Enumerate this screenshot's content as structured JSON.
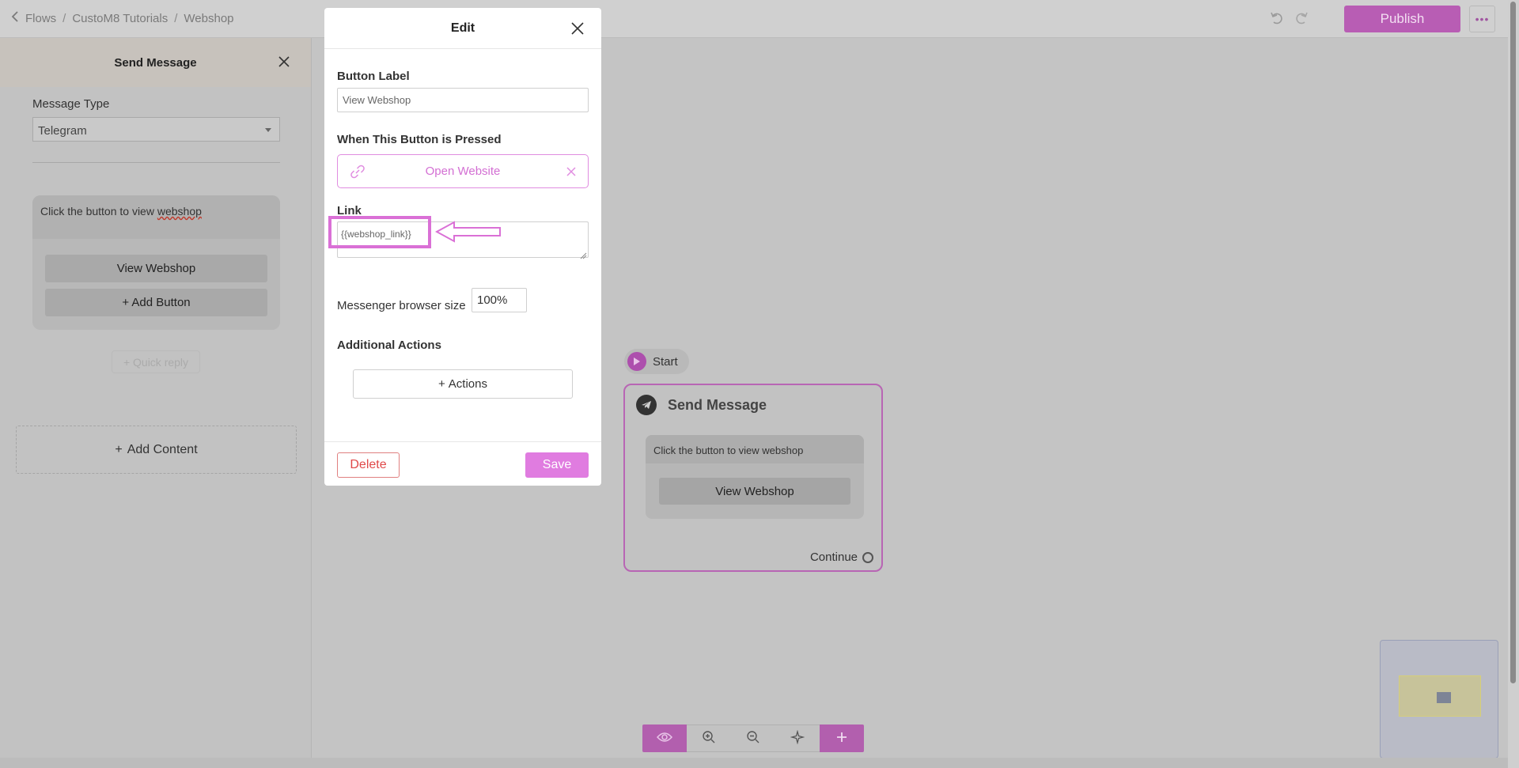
{
  "breadcrumb": {
    "items": [
      "Flows",
      "CustoM8 Tutorials",
      "Webshop"
    ],
    "separator": "/"
  },
  "toolbar": {
    "publish_label": "Publish",
    "more_label": "•••"
  },
  "left_panel": {
    "title": "Send Message",
    "message_type_label": "Message Type",
    "message_type_value": "Telegram",
    "message_text_prefix": "Click the button to view ",
    "message_text_word": "webshop",
    "buttons": [
      "View Webshop",
      "+ Add Button"
    ],
    "quick_reply_label": "+ Quick reply",
    "add_content_label": "Add Content",
    "add_content_plus": "+"
  },
  "canvas": {
    "start_label": "Start",
    "node": {
      "title": "Send Message",
      "text": "Click the button to view webshop",
      "button_label": "View Webshop",
      "continue_label": "Continue"
    }
  },
  "modal": {
    "title": "Edit",
    "button_label_heading": "Button Label",
    "button_label_value": "View Webshop",
    "pressed_heading": "When This Button is Pressed",
    "action_value": "Open Website",
    "link_heading": "Link",
    "link_value": "{{webshop_link}}",
    "browser_size_label": "Messenger browser size",
    "browser_size_value": "100%",
    "additional_actions_heading": "Additional Actions",
    "actions_button_label": "Actions",
    "actions_button_plus": "+",
    "delete_label": "Delete",
    "save_label": "Save"
  },
  "colors": {
    "accent": "#e07ce0",
    "accent_dim": "#b85db4",
    "highlight": "#da70d6",
    "danger": "#e04848"
  },
  "icons": [
    "chevron-left-icon",
    "undo-icon",
    "redo-icon",
    "close-icon",
    "caret-down-icon",
    "play-icon",
    "telegram-icon",
    "link-icon",
    "eye-icon",
    "zoom-in-icon",
    "zoom-out-icon",
    "sparkle-icon",
    "plus-icon",
    "resize-handle-icon",
    "arrow-annotation"
  ]
}
